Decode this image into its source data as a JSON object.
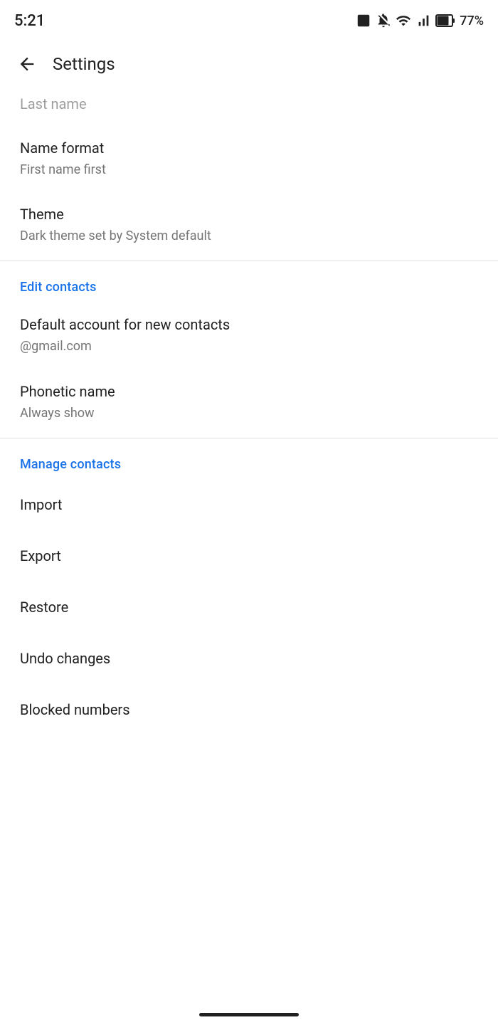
{
  "statusBar": {
    "time": "5:21",
    "battery": "77%",
    "icons": {
      "image": "🖼",
      "mute": "🔕",
      "wifi": "wifi-icon",
      "signal": "signal-icon",
      "battery": "battery-icon"
    }
  },
  "header": {
    "back_label": "←",
    "title": "Settings"
  },
  "partialItem": {
    "label": "Last name"
  },
  "items": [
    {
      "title": "Name format",
      "subtitle": "First name first"
    },
    {
      "title": "Theme",
      "subtitle": "Dark theme set by System default"
    }
  ],
  "sections": [
    {
      "title": "Edit contacts",
      "items": [
        {
          "title": "Default account for new contacts",
          "subtitle": "@gmail.com"
        },
        {
          "title": "Phonetic name",
          "subtitle": "Always show"
        }
      ]
    },
    {
      "title": "Manage contacts",
      "items": [
        {
          "title": "Import"
        },
        {
          "title": "Export"
        },
        {
          "title": "Restore"
        },
        {
          "title": "Undo changes"
        },
        {
          "title": "Blocked numbers"
        }
      ]
    }
  ]
}
